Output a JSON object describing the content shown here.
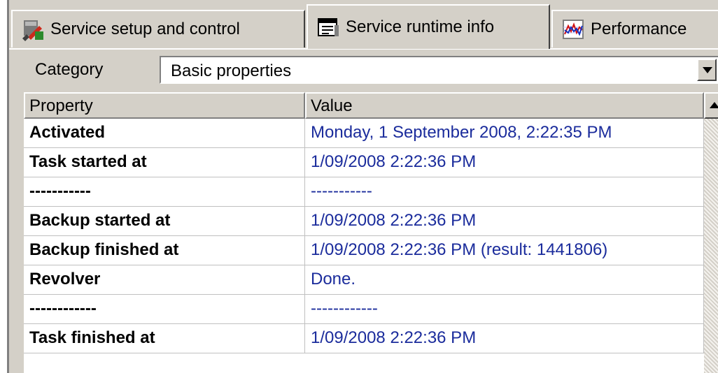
{
  "tabs": [
    {
      "label": "Service setup and control",
      "icon": "tools-icon"
    },
    {
      "label": "Service runtime info",
      "icon": "info-window-icon"
    },
    {
      "label": "Performance",
      "icon": "chart-icon"
    }
  ],
  "category": {
    "label": "Category",
    "selected": "Basic properties"
  },
  "table": {
    "columns": [
      "Property",
      "Value"
    ],
    "rows": [
      {
        "property": "Activated",
        "value": "Monday, 1 September 2008, 2:22:35 PM"
      },
      {
        "property": "Task started at",
        "value": "1/09/2008 2:22:36 PM"
      },
      {
        "property": "-----------",
        "value": "-----------"
      },
      {
        "property": "Backup started at",
        "value": "1/09/2008 2:22:36 PM"
      },
      {
        "property": "Backup finished at",
        "value": "1/09/2008 2:22:36 PM (result: 1441806)"
      },
      {
        "property": "Revolver",
        "value": "Done."
      },
      {
        "property": "------------",
        "value": "------------"
      },
      {
        "property": "Task finished at",
        "value": "1/09/2008 2:22:36 PM"
      }
    ]
  },
  "colors": {
    "window_bg": "#d4d0c8",
    "value_text": "#1b2c9c"
  }
}
